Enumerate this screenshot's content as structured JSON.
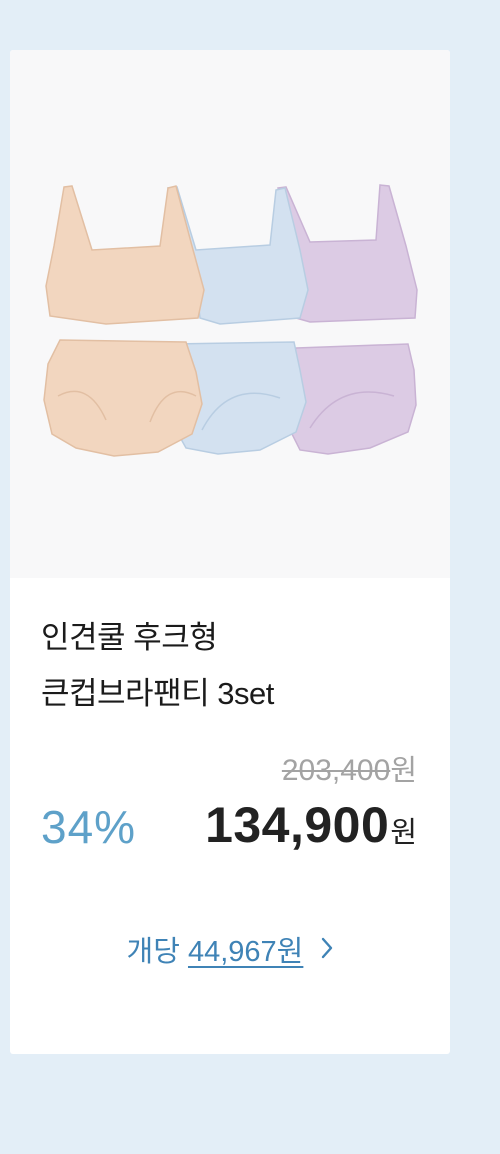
{
  "product": {
    "image": {
      "alt": "3 colour bra and panty set",
      "colors": {
        "beige": "#f2d6bf",
        "blue": "#d3e1f0",
        "lavender": "#dccbe4"
      }
    },
    "title_line1": "인견쿨 후크형",
    "title_line2": "큰컵브라팬티 3set",
    "original_price": "203,400",
    "original_price_unit": "원",
    "discount": "34%",
    "sale_price": "134,900",
    "sale_price_unit": "원",
    "per_unit_label": "개당",
    "per_unit_price": "44,967원",
    "per_unit_icon": "chevron-right-icon"
  },
  "colors": {
    "page_bg": "#e3eef7",
    "discount": "#5ea1c9",
    "per_unit": "#3f83b6"
  }
}
